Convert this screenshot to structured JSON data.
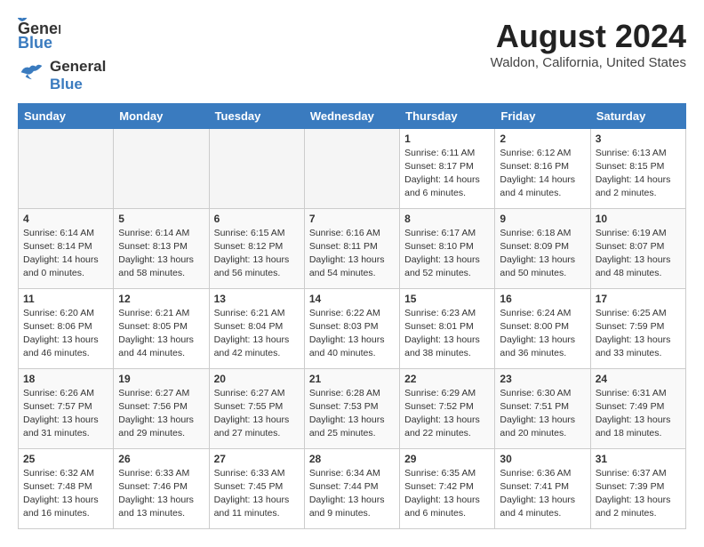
{
  "header": {
    "logo_general": "General",
    "logo_blue": "Blue",
    "month_year": "August 2024",
    "location": "Waldon, California, United States"
  },
  "weekdays": [
    "Sunday",
    "Monday",
    "Tuesday",
    "Wednesday",
    "Thursday",
    "Friday",
    "Saturday"
  ],
  "weeks": [
    [
      {
        "day": "",
        "info": ""
      },
      {
        "day": "",
        "info": ""
      },
      {
        "day": "",
        "info": ""
      },
      {
        "day": "",
        "info": ""
      },
      {
        "day": "1",
        "info": "Sunrise: 6:11 AM\nSunset: 8:17 PM\nDaylight: 14 hours\nand 6 minutes."
      },
      {
        "day": "2",
        "info": "Sunrise: 6:12 AM\nSunset: 8:16 PM\nDaylight: 14 hours\nand 4 minutes."
      },
      {
        "day": "3",
        "info": "Sunrise: 6:13 AM\nSunset: 8:15 PM\nDaylight: 14 hours\nand 2 minutes."
      }
    ],
    [
      {
        "day": "4",
        "info": "Sunrise: 6:14 AM\nSunset: 8:14 PM\nDaylight: 14 hours\nand 0 minutes."
      },
      {
        "day": "5",
        "info": "Sunrise: 6:14 AM\nSunset: 8:13 PM\nDaylight: 13 hours\nand 58 minutes."
      },
      {
        "day": "6",
        "info": "Sunrise: 6:15 AM\nSunset: 8:12 PM\nDaylight: 13 hours\nand 56 minutes."
      },
      {
        "day": "7",
        "info": "Sunrise: 6:16 AM\nSunset: 8:11 PM\nDaylight: 13 hours\nand 54 minutes."
      },
      {
        "day": "8",
        "info": "Sunrise: 6:17 AM\nSunset: 8:10 PM\nDaylight: 13 hours\nand 52 minutes."
      },
      {
        "day": "9",
        "info": "Sunrise: 6:18 AM\nSunset: 8:09 PM\nDaylight: 13 hours\nand 50 minutes."
      },
      {
        "day": "10",
        "info": "Sunrise: 6:19 AM\nSunset: 8:07 PM\nDaylight: 13 hours\nand 48 minutes."
      }
    ],
    [
      {
        "day": "11",
        "info": "Sunrise: 6:20 AM\nSunset: 8:06 PM\nDaylight: 13 hours\nand 46 minutes."
      },
      {
        "day": "12",
        "info": "Sunrise: 6:21 AM\nSunset: 8:05 PM\nDaylight: 13 hours\nand 44 minutes."
      },
      {
        "day": "13",
        "info": "Sunrise: 6:21 AM\nSunset: 8:04 PM\nDaylight: 13 hours\nand 42 minutes."
      },
      {
        "day": "14",
        "info": "Sunrise: 6:22 AM\nSunset: 8:03 PM\nDaylight: 13 hours\nand 40 minutes."
      },
      {
        "day": "15",
        "info": "Sunrise: 6:23 AM\nSunset: 8:01 PM\nDaylight: 13 hours\nand 38 minutes."
      },
      {
        "day": "16",
        "info": "Sunrise: 6:24 AM\nSunset: 8:00 PM\nDaylight: 13 hours\nand 36 minutes."
      },
      {
        "day": "17",
        "info": "Sunrise: 6:25 AM\nSunset: 7:59 PM\nDaylight: 13 hours\nand 33 minutes."
      }
    ],
    [
      {
        "day": "18",
        "info": "Sunrise: 6:26 AM\nSunset: 7:57 PM\nDaylight: 13 hours\nand 31 minutes."
      },
      {
        "day": "19",
        "info": "Sunrise: 6:27 AM\nSunset: 7:56 PM\nDaylight: 13 hours\nand 29 minutes."
      },
      {
        "day": "20",
        "info": "Sunrise: 6:27 AM\nSunset: 7:55 PM\nDaylight: 13 hours\nand 27 minutes."
      },
      {
        "day": "21",
        "info": "Sunrise: 6:28 AM\nSunset: 7:53 PM\nDaylight: 13 hours\nand 25 minutes."
      },
      {
        "day": "22",
        "info": "Sunrise: 6:29 AM\nSunset: 7:52 PM\nDaylight: 13 hours\nand 22 minutes."
      },
      {
        "day": "23",
        "info": "Sunrise: 6:30 AM\nSunset: 7:51 PM\nDaylight: 13 hours\nand 20 minutes."
      },
      {
        "day": "24",
        "info": "Sunrise: 6:31 AM\nSunset: 7:49 PM\nDaylight: 13 hours\nand 18 minutes."
      }
    ],
    [
      {
        "day": "25",
        "info": "Sunrise: 6:32 AM\nSunset: 7:48 PM\nDaylight: 13 hours\nand 16 minutes."
      },
      {
        "day": "26",
        "info": "Sunrise: 6:33 AM\nSunset: 7:46 PM\nDaylight: 13 hours\nand 13 minutes."
      },
      {
        "day": "27",
        "info": "Sunrise: 6:33 AM\nSunset: 7:45 PM\nDaylight: 13 hours\nand 11 minutes."
      },
      {
        "day": "28",
        "info": "Sunrise: 6:34 AM\nSunset: 7:44 PM\nDaylight: 13 hours\nand 9 minutes."
      },
      {
        "day": "29",
        "info": "Sunrise: 6:35 AM\nSunset: 7:42 PM\nDaylight: 13 hours\nand 6 minutes."
      },
      {
        "day": "30",
        "info": "Sunrise: 6:36 AM\nSunset: 7:41 PM\nDaylight: 13 hours\nand 4 minutes."
      },
      {
        "day": "31",
        "info": "Sunrise: 6:37 AM\nSunset: 7:39 PM\nDaylight: 13 hours\nand 2 minutes."
      }
    ]
  ]
}
